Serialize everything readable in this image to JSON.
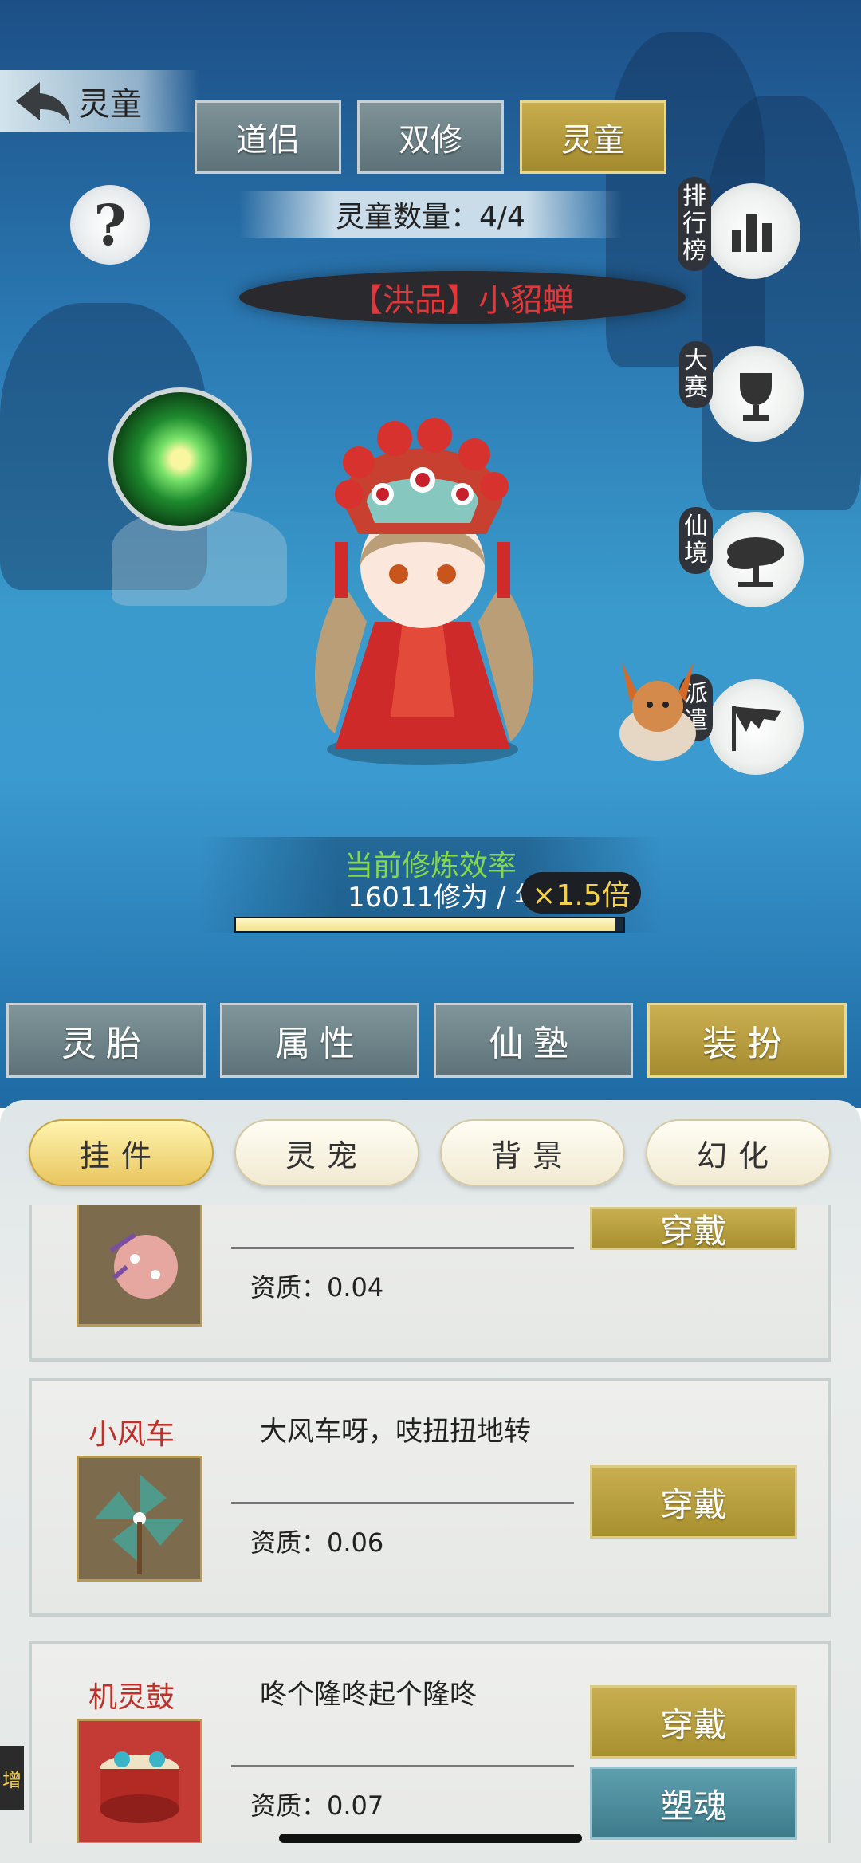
{
  "header": {
    "back_label": "灵童",
    "tabs": [
      {
        "label": "道侣",
        "active": false
      },
      {
        "label": "双修",
        "active": false
      },
      {
        "label": "灵童",
        "active": true
      }
    ],
    "help_symbol": "?",
    "count_text": "灵童数量：4/4"
  },
  "character": {
    "name": "【洪品】小貂蝉",
    "name_color": "#e0383a"
  },
  "side_menu": [
    {
      "label": "排行榜",
      "icon": "ranking-icon"
    },
    {
      "label": "大赛",
      "icon": "trophy-icon"
    },
    {
      "label": "仙境",
      "icon": "tree-icon"
    },
    {
      "label": "派遣",
      "icon": "flag-icon"
    }
  ],
  "efficiency": {
    "title": "当前修炼效率",
    "value": "16011修为 / 年",
    "multiplier": "×1.5倍",
    "progress": 0.98
  },
  "main_tabs": [
    {
      "label": "灵胎",
      "active": false
    },
    {
      "label": "属性",
      "active": false
    },
    {
      "label": "仙塾",
      "active": false
    },
    {
      "label": "装扮",
      "active": true
    }
  ],
  "sub_tabs": [
    {
      "label": "挂件",
      "active": true
    },
    {
      "label": "灵宠",
      "active": false
    },
    {
      "label": "背景",
      "active": false
    },
    {
      "label": "幻化",
      "active": false
    }
  ],
  "items": [
    {
      "name": "",
      "desc": "",
      "quality": "资质：0.04",
      "buttons": [
        "穿戴"
      ],
      "icon": "ornament-ball-icon"
    },
    {
      "name": "小风车",
      "desc": "大风车呀，吱扭扭地转",
      "quality": "资质：0.06",
      "buttons": [
        "穿戴"
      ],
      "icon": "pinwheel-icon"
    },
    {
      "name": "机灵鼓",
      "desc": "咚个隆咚起个隆咚",
      "quality": "资质：0.07",
      "buttons": [
        "穿戴",
        "塑魂"
      ],
      "icon": "drum-icon"
    }
  ],
  "edge_tab_label": "增",
  "colors": {
    "gold": "#b99d3e",
    "slate": "#6c8187",
    "accent_red": "#c0302a"
  }
}
